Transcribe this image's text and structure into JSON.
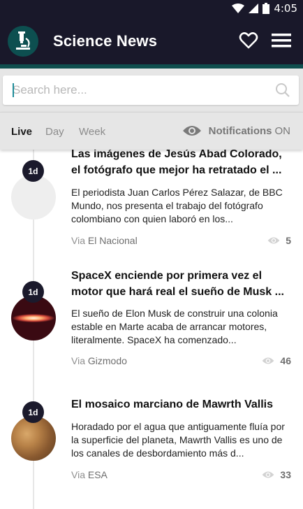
{
  "status_bar": {
    "time": "4:05",
    "icons": [
      "wifi-icon",
      "signal-icon",
      "battery-icon"
    ]
  },
  "app_bar": {
    "title": "Science News",
    "logo_icon": "microscope-icon",
    "favorite_icon": "heart-icon",
    "menu_icon": "hamburger-menu-icon"
  },
  "search": {
    "placeholder": "Search here...",
    "value": ""
  },
  "tabs": [
    {
      "label": "Live",
      "active": true
    },
    {
      "label": "Day",
      "active": false
    },
    {
      "label": "Week",
      "active": false
    }
  ],
  "notifications": {
    "label": "Notifications",
    "state": "ON",
    "icon": "eye-icon"
  },
  "articles": [
    {
      "age": "1d",
      "title": "Las imágenes de Jesús Abad Colorado, el fotógrafo que mejor ha retratado el ...",
      "summary": "El periodista Juan Carlos Pérez Salazar, de BBC Mundo, nos presenta el trabajo del fotógrafo colombiano con quien laboró en los...",
      "via_label": "Via",
      "source": "El Nacional",
      "views": "5",
      "thumb": "blank"
    },
    {
      "age": "1d",
      "title": "SpaceX enciende por primera vez el motor que hará real el sueño de Musk ...",
      "summary": "El sueño de Elon Musk de construir una colonia estable en Marte acaba de arrancar motores, literalmente. SpaceX ha comenzado...",
      "via_label": "Via",
      "source": "Gizmodo",
      "views": "46",
      "thumb": "engine-flame"
    },
    {
      "age": "1d",
      "title": "El mosaico marciano de Mawrth Vallis",
      "summary": "Horadado por el agua que antiguamente fluía por la superficie del planeta, Mawrth Vallis es uno de los canales de desbordamiento más d...",
      "via_label": "Via",
      "source": "ESA",
      "views": "33",
      "thumb": "mars-surface"
    }
  ],
  "colors": {
    "app_bar": "#19182a",
    "accent": "#0f4e4e",
    "toolbar_bg": "#e6e6e6",
    "badge": "#1b1a2c"
  }
}
